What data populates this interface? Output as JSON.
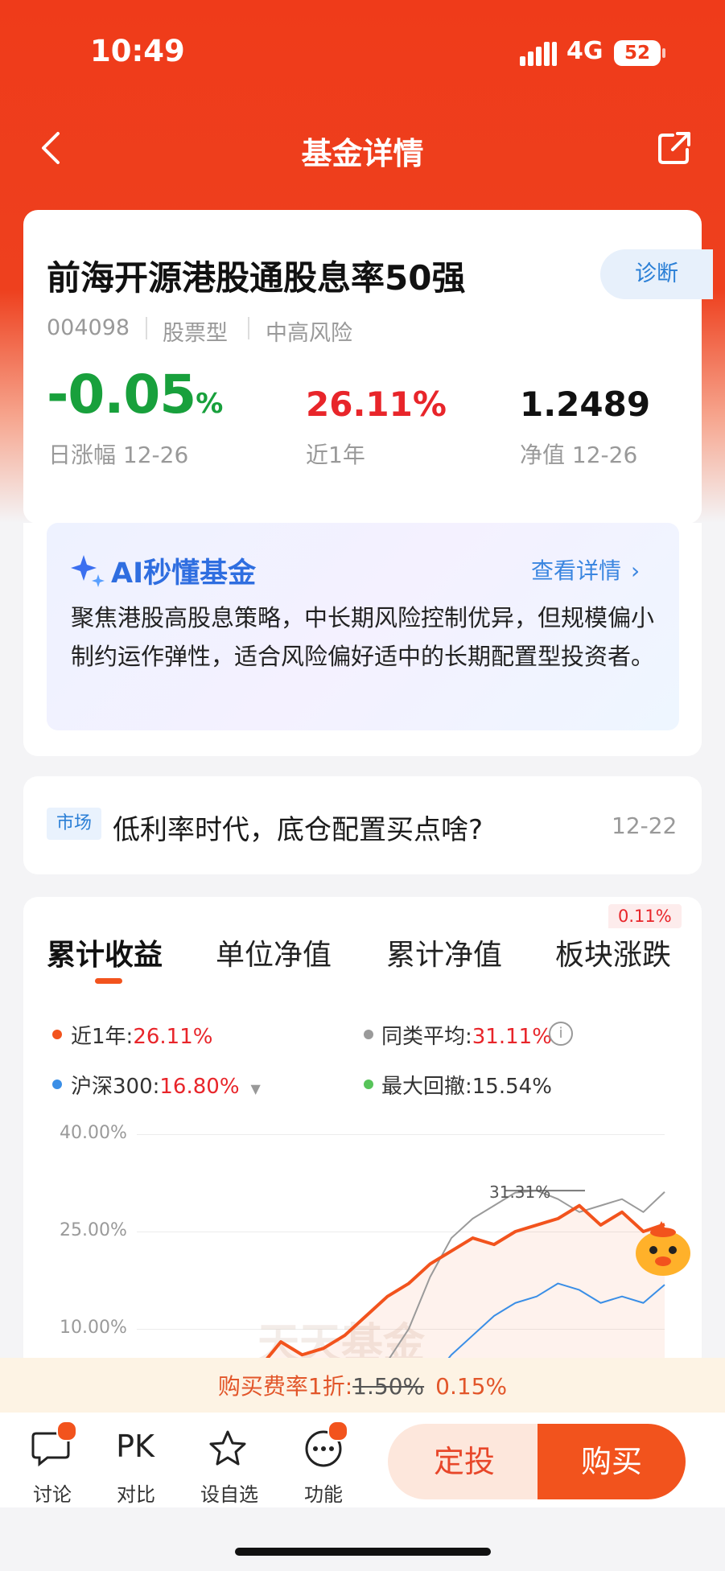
{
  "status_bar": {
    "time": "10:49",
    "network": "4G",
    "battery": "52"
  },
  "nav": {
    "title": "基金详情"
  },
  "fund": {
    "name": "前海开源港股通股息率50强",
    "diagnose_label": "诊断",
    "code": "004098",
    "type": "股票型",
    "risk": "中高风险",
    "daily_change": "-0.05",
    "daily_change_unit": "%",
    "daily_change_label": "日涨幅 12-26",
    "one_year_return": "26.11%",
    "one_year_label": "近1年",
    "nav_value": "1.2489",
    "nav_label": "净值 12-26"
  },
  "ai": {
    "title": "AI秒懂基金",
    "link": "查看详情",
    "text": "聚焦港股高股息策略，中长期风险控制优异，但规模偏小制约运作弹性，适合风险偏好适中的长期配置型投资者。"
  },
  "news": {
    "tag": "市场",
    "headline": "低利率时代，底仓配置买点啥?",
    "date": "12-22"
  },
  "tabs": [
    {
      "label": "累计收益"
    },
    {
      "label": "单位净值"
    },
    {
      "label": "累计净值"
    },
    {
      "label": "板块涨跌"
    }
  ],
  "tab_badge": "0.11%",
  "legend": {
    "fund_label": "近1年:",
    "fund_value": "26.11%",
    "peer_label": "同类平均:",
    "peer_value": "31.11%",
    "index_label": "沪深300:",
    "index_value": "16.80%",
    "drawdown_label": "最大回撤:",
    "drawdown_value": "15.54%"
  },
  "colors": {
    "fund": "#f2531d",
    "peer": "#9a9a9a",
    "index": "#3a8ee6",
    "drawdown": "#57c45a",
    "brand": "#ef3b1a"
  },
  "chart_data": {
    "type": "line",
    "y_ticks": [
      "40.00%",
      "25.00%",
      "10.00%"
    ],
    "ylim": [
      -20,
      40
    ],
    "peak_annotation": "31.31%",
    "x": [
      0,
      1,
      2,
      3,
      4,
      5,
      6,
      7,
      8,
      9,
      10,
      11,
      12,
      13,
      14,
      15,
      16,
      17,
      18,
      19,
      20,
      21,
      22,
      23,
      24
    ],
    "series": [
      {
        "name": "近1年",
        "values": [
          null,
          null,
          null,
          null,
          null,
          4,
          8,
          6,
          7,
          9,
          12,
          15,
          17,
          20,
          22,
          24,
          23,
          25,
          26,
          27,
          29,
          26,
          28,
          25,
          26.11
        ]
      },
      {
        "name": "同类平均",
        "values": [
          null,
          null,
          null,
          null,
          null,
          null,
          null,
          null,
          null,
          null,
          0,
          5,
          10,
          18,
          24,
          27,
          29,
          31,
          31.31,
          30,
          28,
          29,
          30,
          28,
          31.11
        ]
      },
      {
        "name": "沪深300",
        "values": [
          null,
          null,
          null,
          null,
          null,
          null,
          null,
          null,
          null,
          null,
          null,
          null,
          null,
          2,
          6,
          9,
          12,
          14,
          15,
          17,
          16,
          14,
          15,
          14,
          16.8
        ]
      }
    ]
  },
  "watermark": "天天基金",
  "fee": {
    "prefix": "购买费率1折:",
    "original": "1.50%",
    "current": "0.15%"
  },
  "bottom_nav": [
    {
      "label": "讨论"
    },
    {
      "label": "对比",
      "icon_text": "PK"
    },
    {
      "label": "设自选"
    },
    {
      "label": "功能"
    }
  ],
  "actions": {
    "dingtou": "定投",
    "buy": "购买"
  }
}
